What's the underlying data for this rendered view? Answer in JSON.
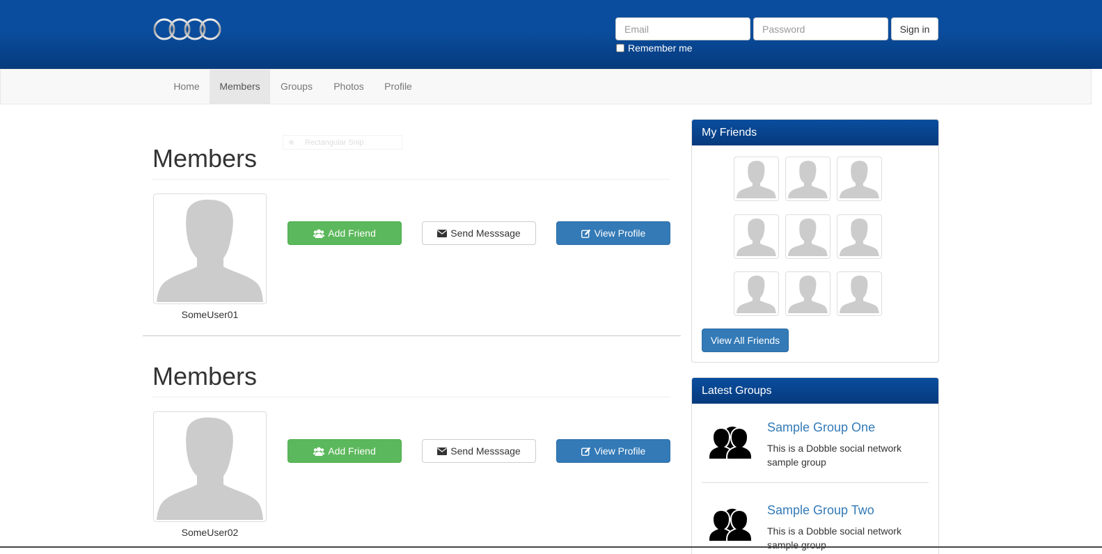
{
  "header": {
    "email_placeholder": "Email",
    "password_placeholder": "Password",
    "signin_label": "Sign in",
    "remember_label": "Remember me"
  },
  "nav": {
    "items": [
      {
        "label": "Home",
        "active": false
      },
      {
        "label": "Members",
        "active": true
      },
      {
        "label": "Groups",
        "active": false
      },
      {
        "label": "Photos",
        "active": false
      },
      {
        "label": "Profile",
        "active": false
      }
    ]
  },
  "main": {
    "ghost_field": "Rectangular Snip",
    "sections": [
      {
        "heading": "Members",
        "username": "SomeUser01",
        "add_friend_label": "Add Friend",
        "send_message_label": "Send Messsage",
        "view_profile_label": "View Profile"
      },
      {
        "heading": "Members",
        "username": "SomeUser02",
        "add_friend_label": "Add Friend",
        "send_message_label": "Send Messsage",
        "view_profile_label": "View Profile"
      }
    ]
  },
  "sidebar": {
    "friends": {
      "title": "My Friends",
      "view_all_label": "View All Friends"
    },
    "groups": {
      "title": "Latest Groups",
      "items": [
        {
          "title": "Sample Group One",
          "description": "This is a Dobble social network sample group"
        },
        {
          "title": "Sample Group Two",
          "description": "This is a Dobble social network sample group"
        }
      ]
    }
  },
  "colors": {
    "header_blue": "#0a4d9e",
    "success_green": "#5cb85c",
    "primary_blue": "#337ab7",
    "nav_bg": "#f8f8f8"
  },
  "icons": {
    "logo": "four-rings-logo",
    "add_friend": "users-icon",
    "send_message": "envelope-icon",
    "view_profile": "edit-icon",
    "avatar": "user-silhouette-icon",
    "group": "group-silhouette-icon"
  }
}
